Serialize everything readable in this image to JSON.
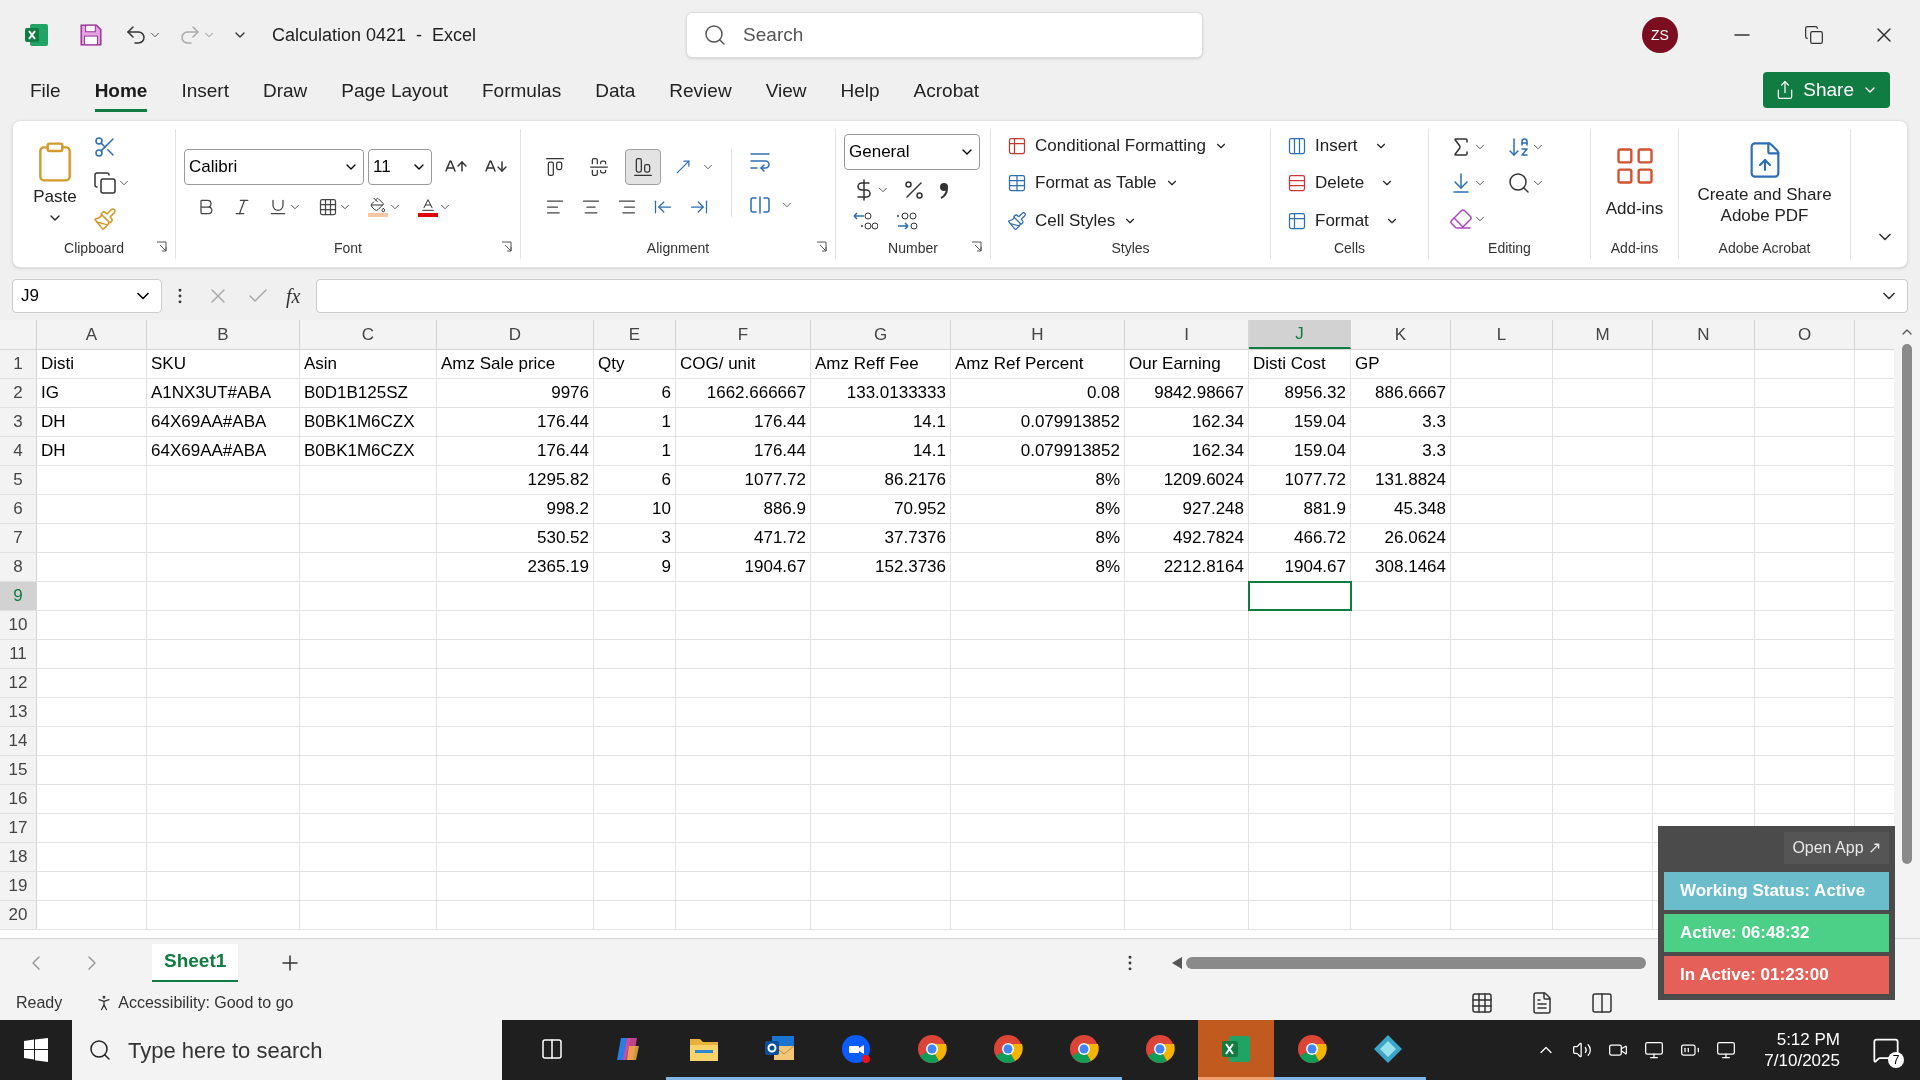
{
  "window": {
    "title": "Calculation 0421  -  Excel",
    "search_placeholder": "Search",
    "user_initials": "ZS"
  },
  "menu_tabs": [
    {
      "label": "File",
      "selected": false
    },
    {
      "label": "Home",
      "selected": true
    },
    {
      "label": "Insert",
      "selected": false
    },
    {
      "label": "Draw",
      "selected": false
    },
    {
      "label": "Page Layout",
      "selected": false
    },
    {
      "label": "Formulas",
      "selected": false
    },
    {
      "label": "Data",
      "selected": false
    },
    {
      "label": "Review",
      "selected": false
    },
    {
      "label": "View",
      "selected": false
    },
    {
      "label": "Help",
      "selected": false
    },
    {
      "label": "Acrobat",
      "selected": false
    }
  ],
  "share_button": "Share",
  "ribbon": {
    "clipboard": {
      "label": "Clipboard",
      "paste": "Paste"
    },
    "font": {
      "label": "Font",
      "font_name": "Calibri",
      "font_size": "11"
    },
    "alignment": {
      "label": "Alignment",
      "vertical": [
        {
          "kind": "top",
          "selected": false
        },
        {
          "kind": "middle",
          "selected": false
        },
        {
          "kind": "bottom",
          "selected": true
        }
      ]
    },
    "number": {
      "label": "Number",
      "format": "General"
    },
    "styles": {
      "label": "Styles",
      "commands": [
        {
          "kind": "conditional",
          "label": "Conditional Formatting"
        },
        {
          "kind": "table",
          "label": "Format as Table"
        },
        {
          "kind": "cellstyles",
          "label": "Cell Styles"
        }
      ]
    },
    "cells": {
      "label": "Cells",
      "commands": [
        {
          "kind": "insert",
          "label": "Insert"
        },
        {
          "kind": "delete",
          "label": "Delete"
        },
        {
          "kind": "format",
          "label": "Format"
        }
      ]
    },
    "editing": {
      "label": "Editing"
    },
    "addins": {
      "label": "Add-ins",
      "button": "Add-ins"
    },
    "acrobat": {
      "label": "Adobe Acrobat",
      "button": "Create and Share Adobe PDF"
    }
  },
  "formula_bar": {
    "name_box": "J9",
    "function_label": "fx"
  },
  "columns": [
    {
      "letter": "A",
      "selected": false
    },
    {
      "letter": "B",
      "selected": false
    },
    {
      "letter": "C",
      "selected": false
    },
    {
      "letter": "D",
      "selected": false
    },
    {
      "letter": "E",
      "selected": false
    },
    {
      "letter": "F",
      "selected": false
    },
    {
      "letter": "G",
      "selected": false
    },
    {
      "letter": "H",
      "selected": false
    },
    {
      "letter": "I",
      "selected": false
    },
    {
      "letter": "J",
      "selected": true
    },
    {
      "letter": "K",
      "selected": false
    },
    {
      "letter": "L",
      "selected": false
    },
    {
      "letter": "M",
      "selected": false
    },
    {
      "letter": "N",
      "selected": false
    },
    {
      "letter": "O",
      "selected": false
    }
  ],
  "rows": [
    {
      "number": "1",
      "selected": false,
      "cells": [
        "Disti",
        "SKU",
        "Asin",
        "Amz Sale price",
        "Qty",
        "COG/ unit",
        "Amz Reff Fee",
        "Amz Ref Percent",
        "Our Earning",
        "Disti Cost",
        "GP"
      ]
    },
    {
      "number": "2",
      "selected": false,
      "cells": [
        "IG",
        "A1NX3UT#ABA",
        "B0D1B125SZ",
        "9976",
        "6",
        "1662.666667",
        "133.0133333",
        "0.08",
        "9842.98667",
        "8956.32",
        "886.6667"
      ]
    },
    {
      "number": "3",
      "selected": false,
      "cells": [
        "DH",
        "64X69AA#ABA",
        "B0BK1M6CZX",
        "176.44",
        "1",
        "176.44",
        "14.1",
        "0.079913852",
        "162.34",
        "159.04",
        "3.3"
      ]
    },
    {
      "number": "4",
      "selected": false,
      "cells": [
        "DH",
        "64X69AA#ABA",
        "B0BK1M6CZX",
        "176.44",
        "1",
        "176.44",
        "14.1",
        "0.079913852",
        "162.34",
        "159.04",
        "3.3"
      ]
    },
    {
      "number": "5",
      "selected": false,
      "cells": [
        null,
        null,
        null,
        "1295.82",
        "6",
        "1077.72",
        "86.2176",
        "8%",
        "1209.6024",
        "1077.72",
        "131.8824"
      ]
    },
    {
      "number": "6",
      "selected": false,
      "cells": [
        null,
        null,
        null,
        "998.2",
        "10",
        "886.9",
        "70.952",
        "8%",
        "927.248",
        "881.9",
        "45.348"
      ]
    },
    {
      "number": "7",
      "selected": false,
      "cells": [
        null,
        null,
        null,
        "530.52",
        "3",
        "471.72",
        "37.7376",
        "8%",
        "492.7824",
        "466.72",
        "26.0624"
      ]
    },
    {
      "number": "8",
      "selected": false,
      "cells": [
        null,
        null,
        null,
        "2365.19",
        "9",
        "1904.67",
        "152.3736",
        "8%",
        "2212.8164",
        "1904.67",
        "308.1464"
      ]
    },
    {
      "number": "9",
      "selected": true
    },
    {
      "number": "10",
      "selected": false
    },
    {
      "number": "11",
      "selected": false
    },
    {
      "number": "12",
      "selected": false
    },
    {
      "number": "13",
      "selected": false
    },
    {
      "number": "14",
      "selected": false
    },
    {
      "number": "15",
      "selected": false
    },
    {
      "number": "16",
      "selected": false
    },
    {
      "number": "17",
      "selected": false
    },
    {
      "number": "18",
      "selected": false
    },
    {
      "number": "19",
      "selected": false
    },
    {
      "number": "20",
      "selected": false
    }
  ],
  "sheets": [
    {
      "label": "Sheet1",
      "selected": true
    }
  ],
  "status_bar": {
    "mode": "Ready",
    "accessibility": "Accessibility: Good to go"
  },
  "tracker_widget": {
    "open_link": "Open App ↗",
    "lines": [
      {
        "text": "Working Status: Active",
        "color": "#6cbdcc"
      },
      {
        "text": "Active: 06:48:32",
        "color": "#4ccf86"
      },
      {
        "text": "In Active: 01:23:00",
        "color": "#e6605a"
      }
    ]
  },
  "taskbar": {
    "search_placeholder": "Type here to search",
    "apps": [
      {
        "kind": "taskview",
        "open": false,
        "selected": false
      },
      {
        "kind": "assistant",
        "open": false,
        "selected": false
      },
      {
        "kind": "folder",
        "open": true,
        "selected": false
      },
      {
        "kind": "mail",
        "open": true,
        "selected": false
      },
      {
        "kind": "video",
        "open": true,
        "selected": false
      },
      {
        "kind": "browser",
        "open": true,
        "selected": false
      },
      {
        "kind": "browser",
        "open": true,
        "selected": false
      },
      {
        "kind": "browser",
        "open": true,
        "selected": false
      },
      {
        "kind": "browser",
        "open": false,
        "selected": false
      },
      {
        "kind": "spreadsheet",
        "open": true,
        "selected": true
      },
      {
        "kind": "browser",
        "open": true,
        "selected": false
      },
      {
        "kind": "diamond",
        "open": true,
        "selected": false
      }
    ],
    "time": "5:12 PM",
    "date": "7/10/2025",
    "notifications": "7"
  }
}
